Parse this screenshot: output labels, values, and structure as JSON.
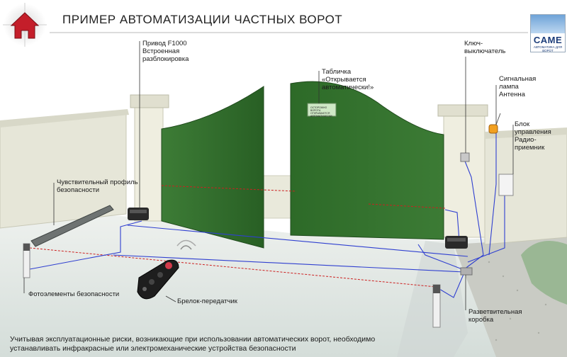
{
  "title": "ПРИМЕР АВТОМАТИЗАЦИИ ЧАСТНЫХ ВОРОТ",
  "brand": {
    "name": "CAME",
    "tagline": "АВТОМАТИКА ДЛЯ ВОРОТ"
  },
  "labels": {
    "drive": "Привод F1000\nВстроенная\nразблокировка",
    "sign": "Табличка\n«Открывается\nавтоматически!»",
    "key_switch": "Ключ-\nвыключатель",
    "signal_lamp": "Сигнальная\nлампа\nАнтенна",
    "control_unit": "Блок\nуправления\nРадио-\nприемник",
    "safety_edge": "Чувствительный профиль\nбезопасности",
    "photocells": "Фотоэлементы безопасности",
    "remote": "Брелок-передатчик",
    "junction_box": "Разветвительная\nкоробка"
  },
  "sign_plate": "ОСТОРОЖНО ВОРОТА\nОТКРЫВАЮТСЯ\nАВТОМАТИЧЕСКИ",
  "footer": "Учитывая эксплуатационные  риски, возникающие при использовании автоматических ворот, необходимо\nустанавливать инфракрасные или электромеханические устройства безопасности",
  "colors": {
    "gate": "#2f6f2a",
    "wall": "#e8e8da",
    "ground": "#dfe6e3",
    "wiring": "#2f3fd0",
    "beam": "#cc2020",
    "house_icon": "#c41e2a"
  }
}
